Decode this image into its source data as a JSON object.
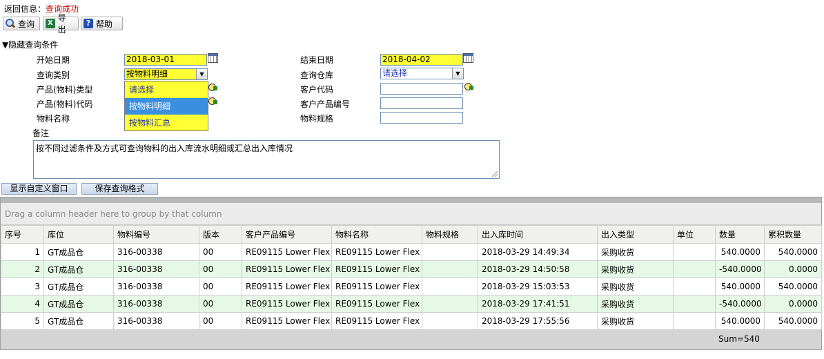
{
  "message": {
    "label": "返回信息：",
    "status": "查询成功",
    "status_color": "#d40000"
  },
  "toolbar": {
    "query": "查询",
    "export": "导出",
    "help": "帮助"
  },
  "toggle_label": "隐藏查询条件",
  "form": {
    "start_date_label": "开始日期",
    "start_date_value": "2018-03-01",
    "end_date_label": "结束日期",
    "end_date_value": "2018-04-02",
    "query_type_label": "查询类别",
    "query_type_value": "按物料明细",
    "warehouse_label": "查询仓库",
    "warehouse_value": "请选择",
    "product_type_label": "产品(物料)类型",
    "customer_code_label": "客户代码",
    "product_code_label": "产品(物料)代码",
    "customer_product_no_label": "客户产品编号",
    "material_name_label": "物料名称",
    "material_spec_label": "物料规格",
    "remark_label": "备注",
    "remark_value": "按不同过滤条件及方式可查询物料的出入库流水明细或汇总出入库情况"
  },
  "dropdown_options": [
    "请选择",
    "按物料明细",
    "按物料汇总"
  ],
  "buttons": {
    "show_custom": "显示自定义窗口",
    "save_format": "保存查询格式"
  },
  "grid": {
    "group_hint": "Drag a column header here to group by that column",
    "columns": [
      "序号",
      "库位",
      "物料编号",
      "版本",
      "客户产品编号",
      "物料名称",
      "物料规格",
      "出入库时间",
      "出入类型",
      "单位",
      "数量",
      "累积数量"
    ],
    "rows": [
      [
        "1",
        "GT成品仓",
        "316-00338",
        "00",
        "RE09115 Lower Flex",
        "RE09115 Lower Flex",
        "",
        "2018-03-29 14:49:34",
        "采购收货",
        "",
        "540.0000",
        "540.0000"
      ],
      [
        "2",
        "GT成品仓",
        "316-00338",
        "00",
        "RE09115 Lower Flex",
        "RE09115 Lower Flex",
        "",
        "2018-03-29 14:50:58",
        "采购收货",
        "",
        "-540.0000",
        "0.0000"
      ],
      [
        "3",
        "GT成品仓",
        "316-00338",
        "00",
        "RE09115 Lower Flex",
        "RE09115 Lower Flex",
        "",
        "2018-03-29 15:03:53",
        "采购收货",
        "",
        "540.0000",
        "540.0000"
      ],
      [
        "4",
        "GT成品仓",
        "316-00338",
        "00",
        "RE09115 Lower Flex",
        "RE09115 Lower Flex",
        "",
        "2018-03-29 17:41:51",
        "采购收货",
        "",
        "-540.0000",
        "0.0000"
      ],
      [
        "5",
        "GT成品仓",
        "316-00338",
        "00",
        "RE09115 Lower Flex",
        "RE09115 Lower Flex",
        "",
        "2018-03-29 17:55:56",
        "采购收货",
        "",
        "540.0000",
        "540.0000"
      ]
    ],
    "footer_sum": "Sum=540"
  },
  "colors": {
    "field_highlight": "#ffff33",
    "row_alt": "#e6f8e6",
    "selected_option": "#3b8fe0"
  }
}
